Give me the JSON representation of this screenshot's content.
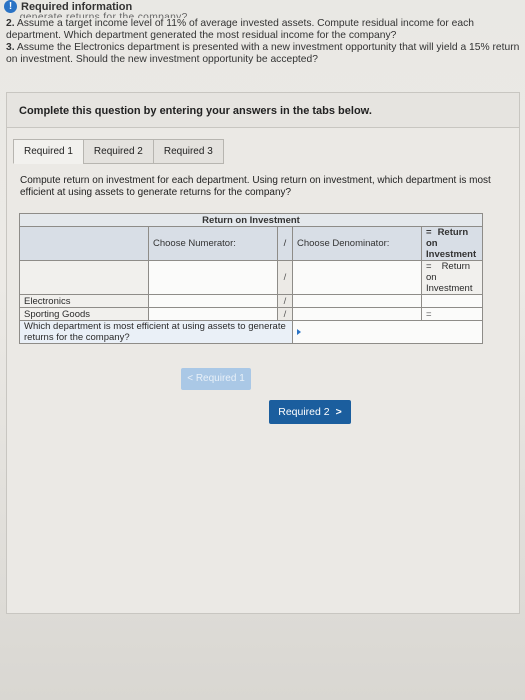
{
  "header": {
    "title": "Required information"
  },
  "intro": {
    "cut_line": "… generate returns for the company?",
    "q2_num": "2.",
    "q2_text": "Assume a target income level of 11% of average invested assets. Compute residual income for each department. Which department generated the most residual income for the company?",
    "q3_num": "3.",
    "q3_text": "Assume the Electronics department is presented with a new investment opportunity that will yield a 15% return on investment. Should the new investment opportunity be accepted?"
  },
  "panel": {
    "heading": "Complete this question by entering your answers in the tabs below.",
    "tabs": [
      "Required 1",
      "Required 2",
      "Required 3"
    ],
    "task": "Compute return on investment for each department. Using return on investment, which department is most efficient at using assets to generate returns for the company?",
    "table": {
      "title": "Return on Investment",
      "headers": {
        "numerator": "Choose Numerator:",
        "op1": "/",
        "denominator": "Choose Denominator:",
        "op2": "=",
        "result": "Return on Investment"
      },
      "subheader_result": "Return on Investment",
      "rows": [
        {
          "label": "Electronics",
          "op1": "/",
          "op2": "="
        },
        {
          "label": "Sporting Goods",
          "op1": "/",
          "op2": "="
        }
      ],
      "question": "Which department is most efficient at using assets to generate returns for the company?"
    },
    "prev_button": "< Required 1",
    "next_button": "Required 2",
    "next_chevron": ">"
  }
}
